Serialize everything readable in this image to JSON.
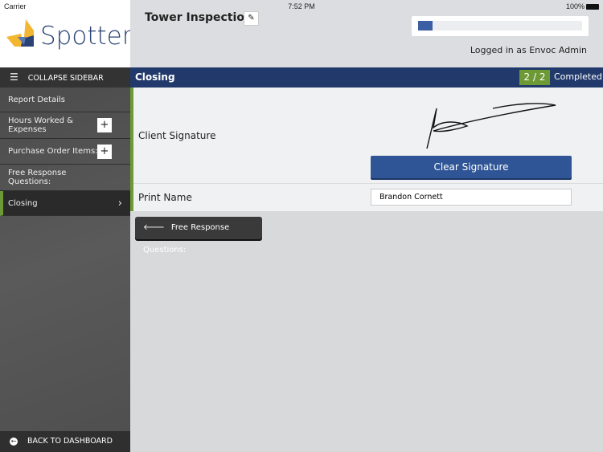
{
  "status": {
    "carrier": "Carrier",
    "time": "7:52 PM",
    "battery": "100%"
  },
  "logo": {
    "text": "Spotter"
  },
  "header": {
    "title": "Tower Inspection",
    "logged_in": "Logged in as Envoc Admin",
    "progress_fraction": 0.09
  },
  "sidebar": {
    "collapse_label": "COLLAPSE SIDEBAR",
    "items": [
      {
        "label": "Report Details"
      },
      {
        "label": "Hours Worked & Expenses",
        "action": "+"
      },
      {
        "label": "Purchase Order Items:",
        "action": "+"
      },
      {
        "label": "Free Response Questions:"
      },
      {
        "label": "Closing",
        "chevron": "›"
      }
    ],
    "back_label": "BACK TO DASHBOARD"
  },
  "section": {
    "name": "Closing",
    "badge": "2 / 2",
    "status": "Completed"
  },
  "form": {
    "signature_label": "Client Signature",
    "clear_label": "Clear Signature",
    "print_name_label": "Print Name",
    "print_name_value": "Brandon Cornett"
  },
  "prev_button": "Free Response Questions:"
}
